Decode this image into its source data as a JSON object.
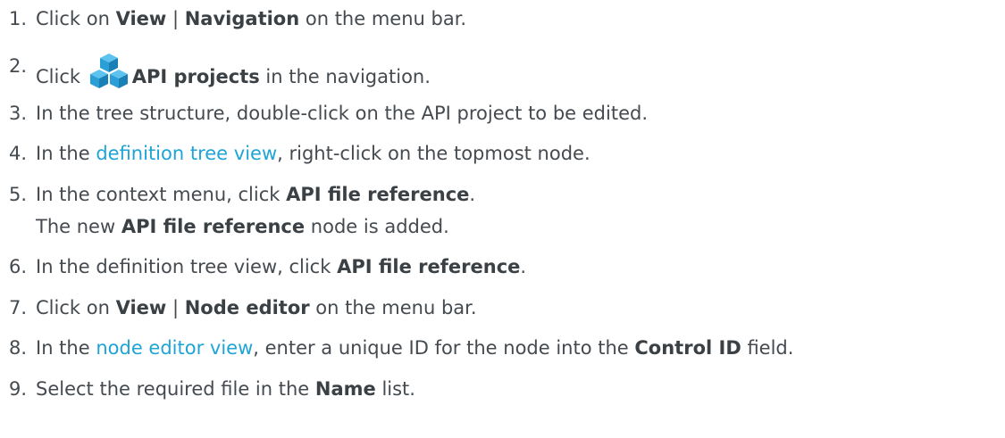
{
  "steps": [
    {
      "number": "1.",
      "pre": "Click on ",
      "b1": "View",
      "sep": " | ",
      "b2": "Navigation",
      "post": " on the menu bar."
    },
    {
      "number": "2.",
      "pre": "Click ",
      "icon": "api-projects-cubes-icon",
      "bold": "API projects",
      "post": " in the navigation."
    },
    {
      "number": "3.",
      "text": "In the tree structure, double-click on the API project to be edited."
    },
    {
      "number": "4.",
      "pre": "In the ",
      "link": "definition tree view",
      "post": ", right-click on the topmost node."
    },
    {
      "number": "5.",
      "pre": "In the context menu, click ",
      "bold": "API file reference",
      "post": ".",
      "note": {
        "pre": "The new ",
        "bold": "API file reference",
        "post": " node is added."
      }
    },
    {
      "number": "6.",
      "pre": "In the definition tree view, click ",
      "bold": "API file reference",
      "post": "."
    },
    {
      "number": "7.",
      "pre": "Click on ",
      "b1": "View",
      "sep": " | ",
      "b2": "Node editor",
      "post": " on the menu bar."
    },
    {
      "number": "8.",
      "pre": "In the ",
      "link": "node editor view",
      "mid": ", enter a unique ID for the node into the ",
      "bold": "Control ID",
      "post": " field."
    },
    {
      "number": "9.",
      "pre": "Select the required file in the ",
      "bold": "Name",
      "post": " list."
    }
  ],
  "colors": {
    "text": "#444a4f",
    "link": "#1ea4d7",
    "icon": "#2a9fd6"
  }
}
